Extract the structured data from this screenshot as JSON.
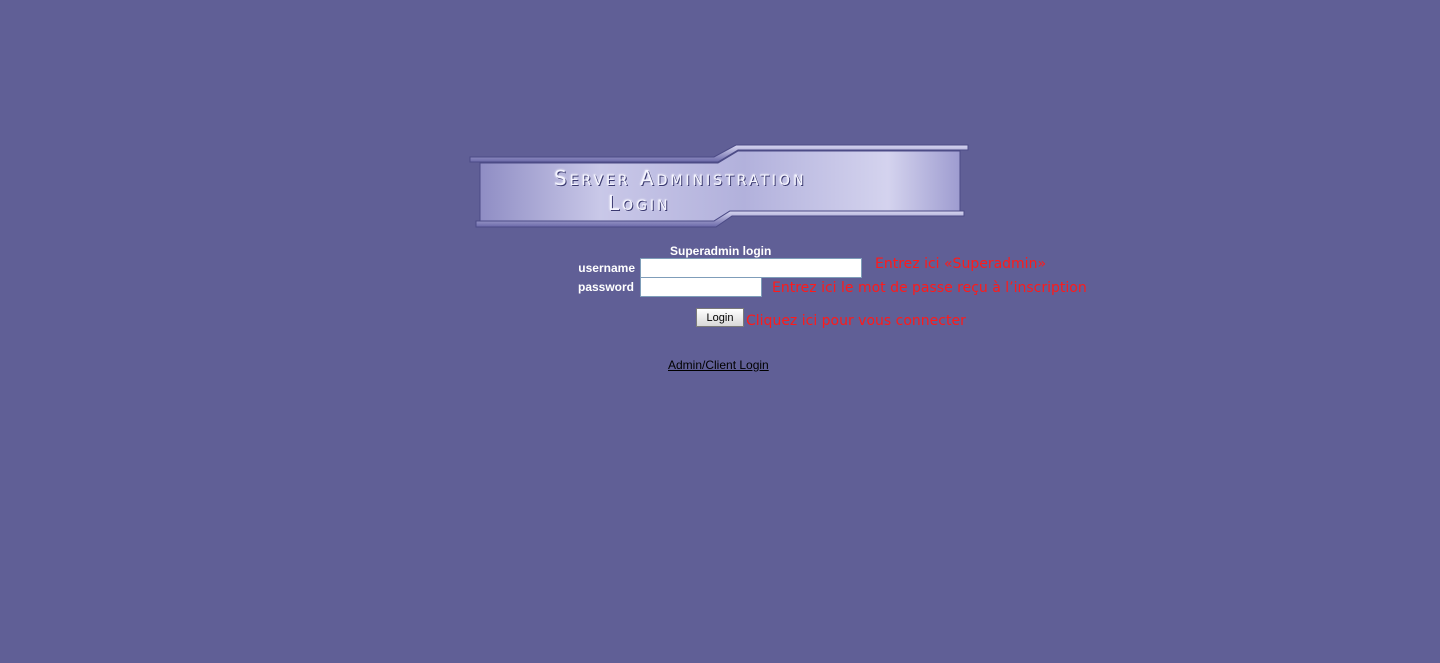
{
  "banner": {
    "line1": "Server Administration",
    "line2": "Login"
  },
  "form": {
    "title": "Superadmin login",
    "username_label": "username",
    "password_label": "password",
    "username_value": "",
    "password_value": "",
    "login_button": "Login"
  },
  "hints": {
    "username": "Entrez ici «Superadmin»",
    "password": "Entrez ici le mot de passe reçu à l’inscription",
    "login": "Cliquez ici pour vous connecter"
  },
  "links": {
    "admin_client": "Admin/Client Login"
  },
  "colors": {
    "background": "#605f96",
    "hint": "#ff1a1a"
  }
}
